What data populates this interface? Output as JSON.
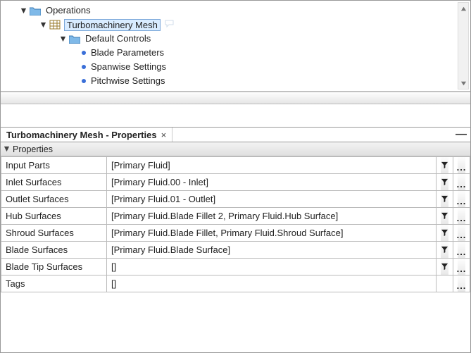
{
  "tree": {
    "operations": "Operations",
    "turbomachinery": "Turbomachinery Mesh",
    "default_controls": "Default Controls",
    "blade_parameters": "Blade Parameters",
    "spanwise": "Spanwise Settings",
    "pitchwise": "Pitchwise Settings"
  },
  "panel": {
    "tab_title": "Turbomachinery Mesh - Properties",
    "section": "Properties"
  },
  "props": {
    "input_parts": {
      "label": "Input Parts",
      "value": "[Primary Fluid]"
    },
    "inlet_surfaces": {
      "label": "Inlet Surfaces",
      "value": "[Primary Fluid.00 - Inlet]"
    },
    "outlet_surfaces": {
      "label": "Outlet Surfaces",
      "value": "[Primary Fluid.01 - Outlet]"
    },
    "hub_surfaces": {
      "label": "Hub Surfaces",
      "value": "[Primary Fluid.Blade Fillet 2, Primary Fluid.Hub Surface]"
    },
    "shroud_surfaces": {
      "label": "Shroud Surfaces",
      "value": "[Primary Fluid.Blade Fillet, Primary Fluid.Shroud Surface]"
    },
    "blade_surfaces": {
      "label": "Blade Surfaces",
      "value": "[Primary Fluid.Blade Surface]"
    },
    "blade_tip_surfaces": {
      "label": "Blade Tip Surfaces",
      "value": "[]"
    },
    "tags": {
      "label": "Tags",
      "value": "[]"
    }
  }
}
